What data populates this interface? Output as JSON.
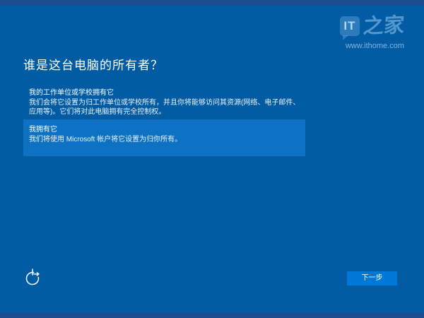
{
  "page": {
    "title": "谁是这台电脑的所有者？"
  },
  "watermark": {
    "logo_it": "IT",
    "logo_cn": "之家",
    "url": "www.ithome.com"
  },
  "options": [
    {
      "title": "我的工作单位或学校拥有它",
      "description": "我们会将它设置为归工作单位或学校所有，并且你将能够访问其资源(网络、电子邮件、应用等)。它们将对此电脑拥有完全控制权。",
      "selected": false
    },
    {
      "title": "我拥有它",
      "description": "我们将使用 Microsoft 帐户将它设置为归你所有。",
      "selected": true
    }
  ],
  "footer": {
    "next_label": "下一步"
  },
  "icons": {
    "ease_of_access_icon": "circle-with-top-line-and-right-arrow",
    "ithome_logo_icon": "speech-bubble-with-IT"
  },
  "colors": {
    "bg": "#015CA4",
    "bar": "#1C4E8F",
    "sel": "#0D72C3",
    "btn": "#0078D7",
    "text": "#FFFFFF",
    "wm": "#428BC8"
  }
}
